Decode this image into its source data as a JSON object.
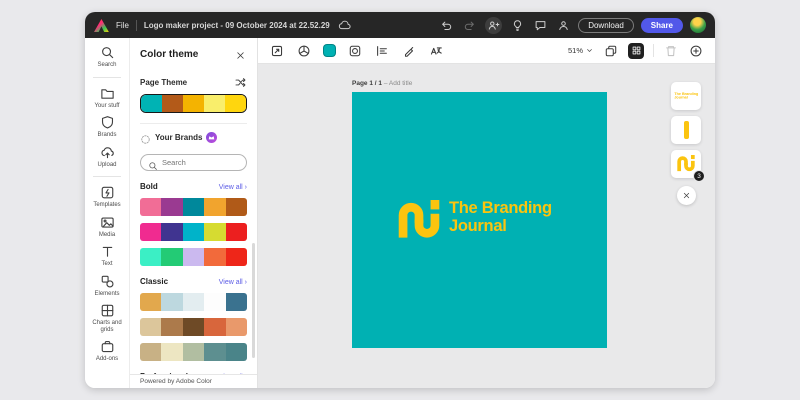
{
  "titlebar": {
    "file_label": "File",
    "project_title": "Logo maker project - 09 October 2024 at 22.52.29",
    "download_label": "Download",
    "share_label": "Share",
    "share_color": "#5258E9",
    "icons": [
      "undo",
      "redo",
      "invite",
      "ideas",
      "comments",
      "account"
    ]
  },
  "rail": {
    "items": [
      {
        "id": "search",
        "label": "Search",
        "icon": "search"
      },
      {
        "id": "your-stuff",
        "label": "Your stuff",
        "icon": "folder",
        "divider_before": true
      },
      {
        "id": "brands",
        "label": "Brands",
        "icon": "shield"
      },
      {
        "id": "upload",
        "label": "Upload",
        "icon": "cloud-upload"
      },
      {
        "id": "templates",
        "label": "Templates",
        "icon": "templates",
        "divider_before": true
      },
      {
        "id": "media",
        "label": "Media",
        "icon": "media"
      },
      {
        "id": "text",
        "label": "Text",
        "icon": "text"
      },
      {
        "id": "elements",
        "label": "Elements",
        "icon": "elements"
      },
      {
        "id": "charts-and-grids",
        "label": "Charts and grids",
        "icon": "grid"
      },
      {
        "id": "add-ons",
        "label": "Add-ons",
        "icon": "addons"
      }
    ]
  },
  "panel": {
    "title": "Color theme",
    "link_color": "#5C5CE6",
    "page_theme": {
      "label": "Page Theme",
      "colors": [
        "#00B3B4",
        "#B35A19",
        "#F4B301",
        "#F9EE6B",
        "#FFD60E"
      ]
    },
    "your_brands_label": "Your Brands",
    "search_placeholder": "Search",
    "sections": [
      {
        "title": "Bold",
        "view_all": "View all ›",
        "rows": [
          [
            "#F16D96",
            "#9A3A91",
            "#00889B",
            "#F1A42E",
            "#B05A18"
          ],
          [
            "#F02B90",
            "#403490",
            "#00B3C9",
            "#D6DB31",
            "#EC1F1F"
          ],
          [
            "#3BEFC5",
            "#23CB75",
            "#CBB9EF",
            "#F26A3B",
            "#EE2619"
          ]
        ]
      },
      {
        "title": "Classic",
        "view_all": "View all ›",
        "rows": [
          [
            "#E2A84D",
            "#BDD8DF",
            "#E3EDF0",
            "#FDFDFD",
            "#3A728F"
          ],
          [
            "#DCC69B",
            "#AC7A4B",
            "#6E4A26",
            "#D8663C",
            "#E9996B"
          ],
          [
            "#C8B185",
            "#EDE6C2",
            "#B1BEA1",
            "#5D8F90",
            "#4A8489"
          ]
        ]
      },
      {
        "title": "Professional",
        "view_all": "View all ›",
        "rows": []
      }
    ],
    "footer": "Powered by Adobe Color"
  },
  "canvas": {
    "zoom": "51%",
    "page_label": "Page 1 / 1",
    "page_label_suffix": "– Add title",
    "background": "#00B1B3",
    "toolbar_left": [
      "resize",
      "color-wheel",
      "fill-color",
      "frame",
      "spacing",
      "pen",
      "translate"
    ],
    "logo": {
      "line1": "The Branding",
      "line2": "Journal",
      "color": "#FBC40F"
    },
    "layer_badge": "3"
  }
}
